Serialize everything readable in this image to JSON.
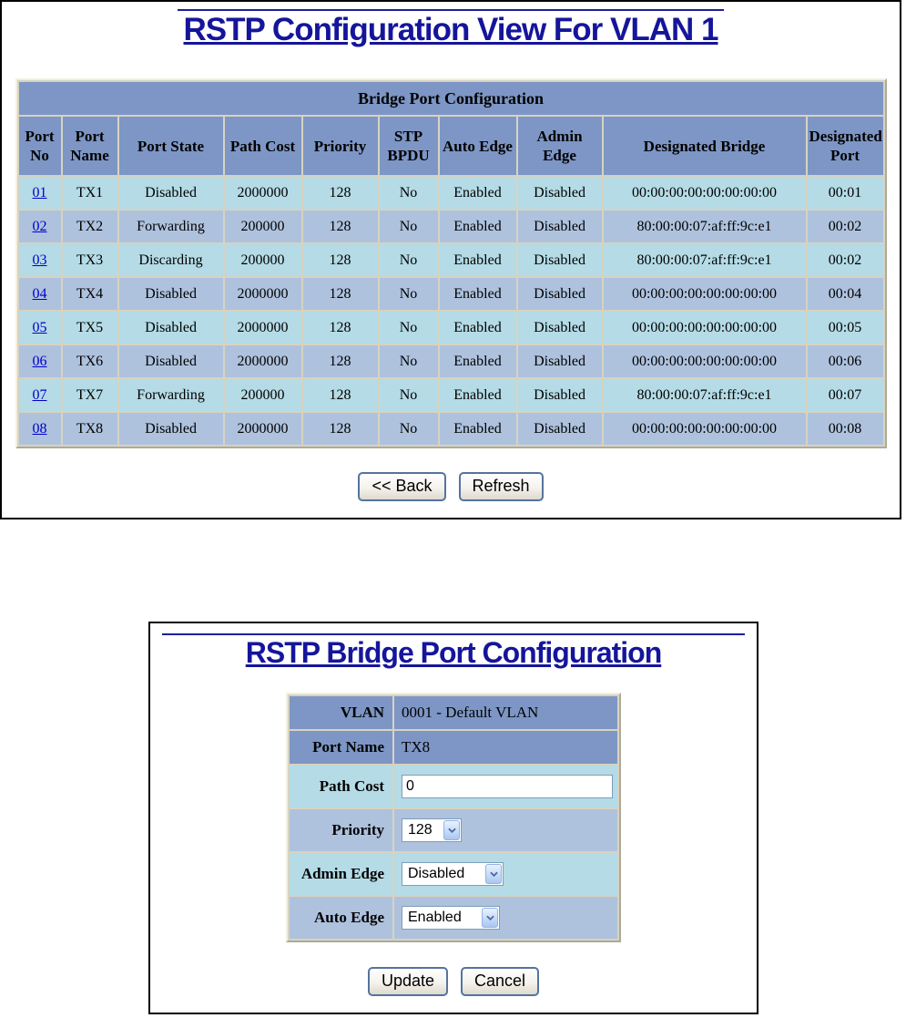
{
  "colors": {
    "title_navy": "#15159b",
    "header_blue": "#7d96c5",
    "row_cyan": "#b4dbe6",
    "row_steel": "#aec2de",
    "link_blue": "#0000cc",
    "panel_border": "#000000"
  },
  "top_panel": {
    "title": "RSTP Configuration View For VLAN 1",
    "table": {
      "caption": "Bridge Port Configuration",
      "headers": [
        "Port No",
        "Port Name",
        "Port State",
        "Path Cost",
        "Priority",
        "STP BPDU",
        "Auto Edge",
        "Admin Edge",
        "Designated Bridge",
        "Designated Port"
      ],
      "rows": [
        {
          "port_no": "01",
          "port_name": "TX1",
          "port_state": "Disabled",
          "path_cost": "2000000",
          "priority": "128",
          "stp_bpdu": "No",
          "auto_edge": "Enabled",
          "admin_edge": "Disabled",
          "designated_bridge": "00:00:00:00:00:00:00:00",
          "designated_port": "00:01"
        },
        {
          "port_no": "02",
          "port_name": "TX2",
          "port_state": "Forwarding",
          "path_cost": "200000",
          "priority": "128",
          "stp_bpdu": "No",
          "auto_edge": "Enabled",
          "admin_edge": "Disabled",
          "designated_bridge": "80:00:00:07:af:ff:9c:e1",
          "designated_port": "00:02"
        },
        {
          "port_no": "03",
          "port_name": "TX3",
          "port_state": "Discarding",
          "path_cost": "200000",
          "priority": "128",
          "stp_bpdu": "No",
          "auto_edge": "Enabled",
          "admin_edge": "Disabled",
          "designated_bridge": "80:00:00:07:af:ff:9c:e1",
          "designated_port": "00:02"
        },
        {
          "port_no": "04",
          "port_name": "TX4",
          "port_state": "Disabled",
          "path_cost": "2000000",
          "priority": "128",
          "stp_bpdu": "No",
          "auto_edge": "Enabled",
          "admin_edge": "Disabled",
          "designated_bridge": "00:00:00:00:00:00:00:00",
          "designated_port": "00:04"
        },
        {
          "port_no": "05",
          "port_name": "TX5",
          "port_state": "Disabled",
          "path_cost": "2000000",
          "priority": "128",
          "stp_bpdu": "No",
          "auto_edge": "Enabled",
          "admin_edge": "Disabled",
          "designated_bridge": "00:00:00:00:00:00:00:00",
          "designated_port": "00:05"
        },
        {
          "port_no": "06",
          "port_name": "TX6",
          "port_state": "Disabled",
          "path_cost": "2000000",
          "priority": "128",
          "stp_bpdu": "No",
          "auto_edge": "Enabled",
          "admin_edge": "Disabled",
          "designated_bridge": "00:00:00:00:00:00:00:00",
          "designated_port": "00:06"
        },
        {
          "port_no": "07",
          "port_name": "TX7",
          "port_state": "Forwarding",
          "path_cost": "200000",
          "priority": "128",
          "stp_bpdu": "No",
          "auto_edge": "Enabled",
          "admin_edge": "Disabled",
          "designated_bridge": "80:00:00:07:af:ff:9c:e1",
          "designated_port": "00:07"
        },
        {
          "port_no": "08",
          "port_name": "TX8",
          "port_state": "Disabled",
          "path_cost": "2000000",
          "priority": "128",
          "stp_bpdu": "No",
          "auto_edge": "Enabled",
          "admin_edge": "Disabled",
          "designated_bridge": "00:00:00:00:00:00:00:00",
          "designated_port": "00:08"
        }
      ]
    },
    "buttons": {
      "back": "<< Back",
      "refresh": "Refresh"
    }
  },
  "bottom_panel": {
    "title": "RSTP Bridge Port Configuration",
    "fields": {
      "vlan": {
        "label": "VLAN",
        "value": "0001 - Default VLAN"
      },
      "port_name": {
        "label": "Port Name",
        "value": "TX8"
      },
      "path_cost": {
        "label": "Path Cost",
        "value": "0"
      },
      "priority": {
        "label": "Priority",
        "value": "128"
      },
      "admin_edge": {
        "label": "Admin Edge",
        "value": "Disabled"
      },
      "auto_edge": {
        "label": "Auto Edge",
        "value": "Enabled"
      }
    },
    "buttons": {
      "update": "Update",
      "cancel": "Cancel"
    }
  }
}
